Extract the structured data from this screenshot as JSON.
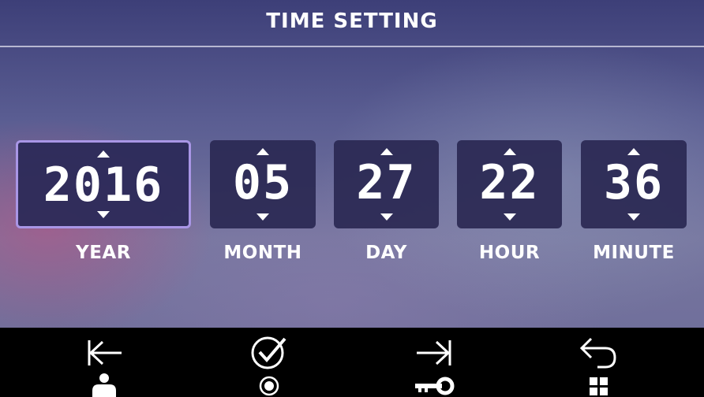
{
  "header": {
    "title": "TIME SETTING"
  },
  "fields": [
    {
      "name": "year",
      "value": "2016",
      "label": "YEAR"
    },
    {
      "name": "month",
      "value": "05",
      "label": "MONTH"
    },
    {
      "name": "day",
      "value": "27",
      "label": "DAY"
    },
    {
      "name": "hour",
      "value": "22",
      "label": "HOUR"
    },
    {
      "name": "minute",
      "value": "36",
      "label": "MINUTE"
    }
  ],
  "selected_field": "year",
  "footer": {
    "buttons": [
      {
        "name": "previous",
        "icon": "arrow-left-bar-icon",
        "sub_icon": "user-icon"
      },
      {
        "name": "confirm",
        "icon": "check-circle-icon",
        "sub_icon": "record-icon"
      },
      {
        "name": "next",
        "icon": "arrow-right-bar-icon",
        "sub_icon": "key-icon"
      },
      {
        "name": "back",
        "icon": "return-icon",
        "sub_icon": "grid-icon"
      }
    ]
  },
  "colors": {
    "selected_border": "#a996e6",
    "field_bg": "#2a2852",
    "text": "#ffffff",
    "footer_bg": "#000000"
  }
}
